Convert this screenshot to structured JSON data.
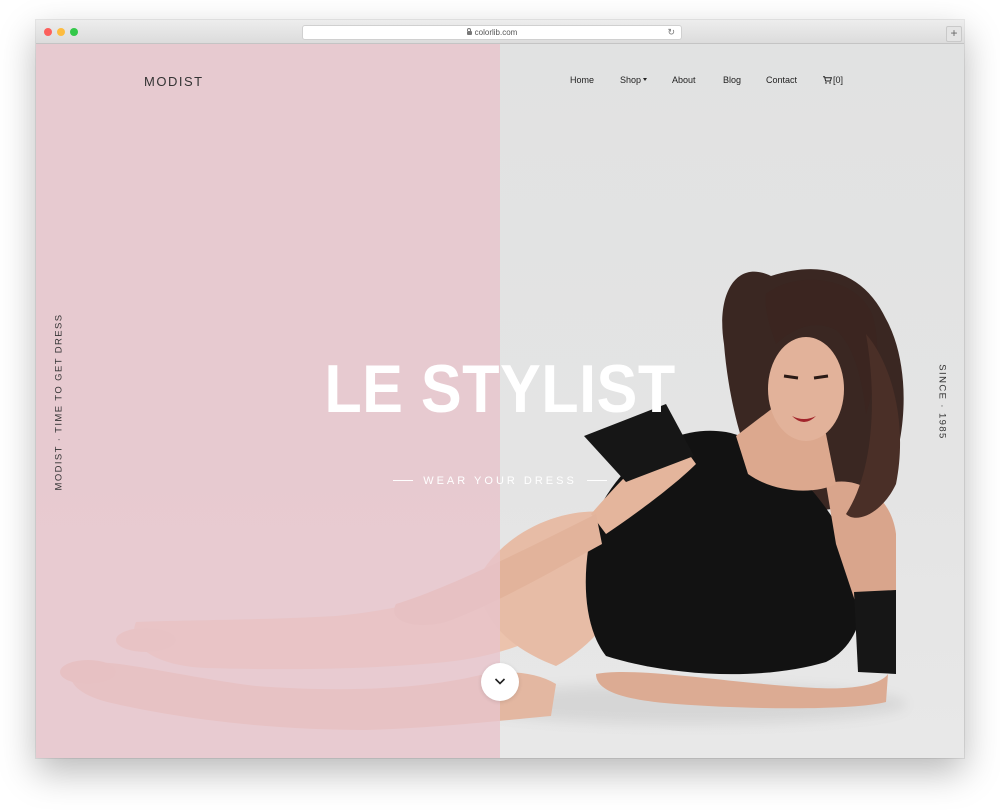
{
  "browser": {
    "url": "colorlib.com",
    "new_tab_symbol": "+",
    "reload_symbol": "↻"
  },
  "site": {
    "logo": "MODIST",
    "nav": [
      {
        "label": "Home"
      },
      {
        "label": "Shop",
        "has_dropdown": true
      },
      {
        "label": "About"
      },
      {
        "label": "Blog"
      },
      {
        "label": "Contact"
      }
    ],
    "cart": {
      "label": "[0]",
      "icon": "cart-icon"
    }
  },
  "hero": {
    "headline": "LE STYLIST",
    "subtitle": "WEAR YOUR DRESS",
    "side_left_text": "MODIST · TIME TO GET DRESS",
    "side_right_text": "SINCE · 1985",
    "scroll_icon": "chevron-down-icon"
  },
  "colors": {
    "pink_panel": "#e8c4cc",
    "right_panel": "#e2e3e3",
    "text_dark": "#222222",
    "headline": "#ffffff"
  }
}
